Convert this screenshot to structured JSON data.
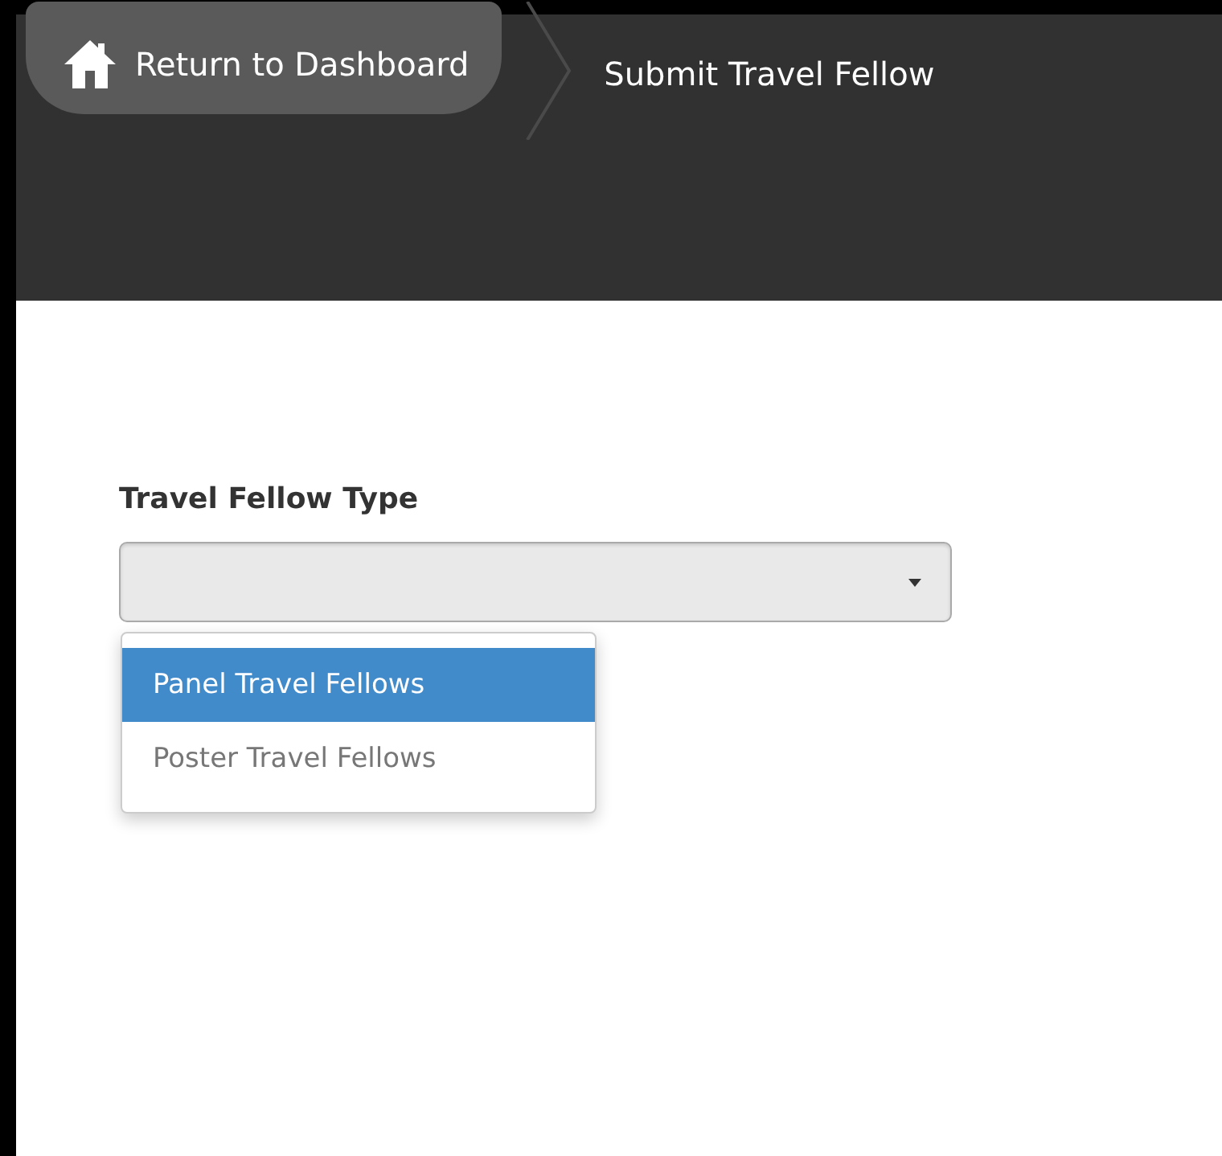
{
  "breadcrumb": [
    {
      "label": "Return to Dashboard",
      "kind": "home"
    },
    {
      "label": "Submit Travel Fellow",
      "kind": "current"
    }
  ],
  "field": {
    "label": "Travel Fellow Type",
    "expanded": true,
    "options": [
      {
        "label": "Panel Travel Fellows",
        "selected": true
      },
      {
        "label": "Poster Travel Fellows",
        "selected": false
      }
    ]
  }
}
